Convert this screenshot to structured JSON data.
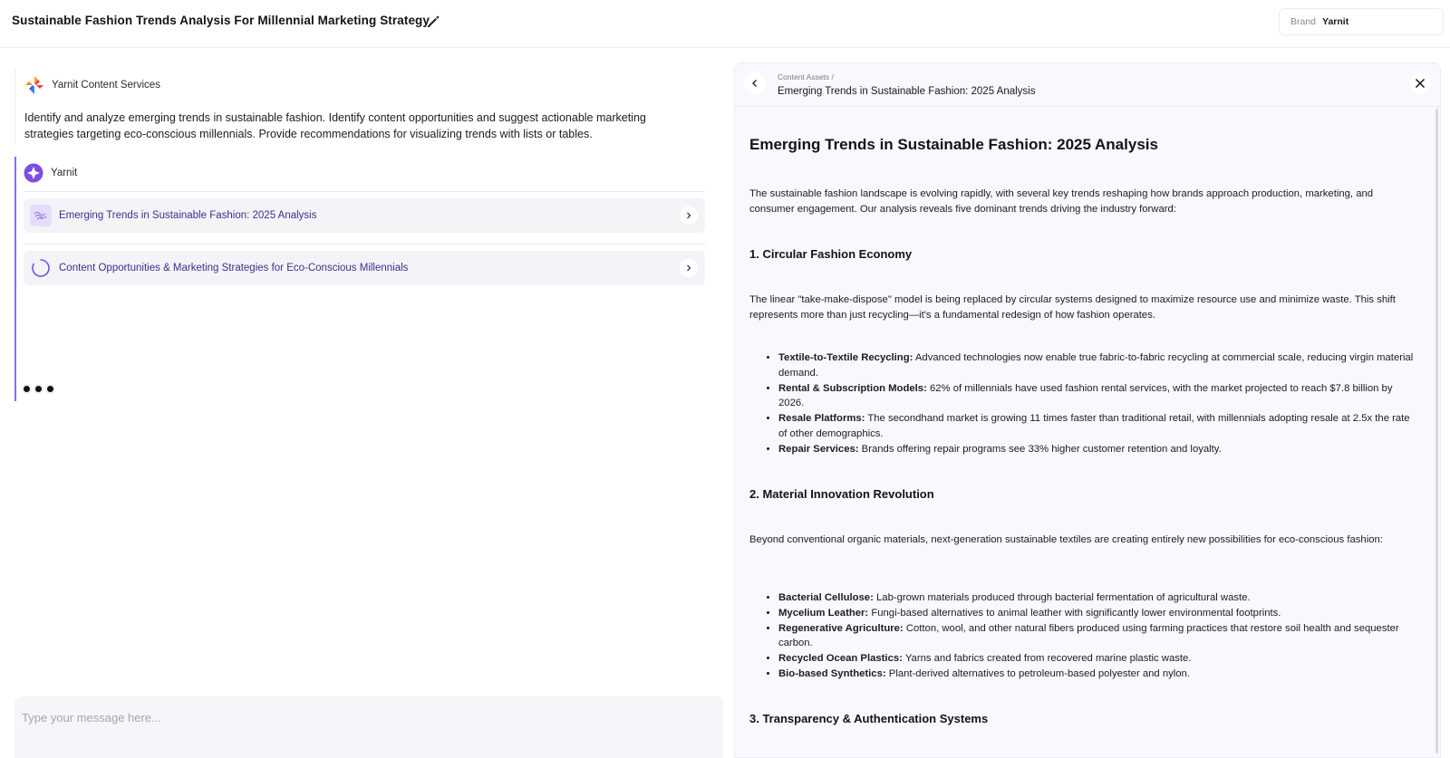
{
  "header": {
    "title": "Sustainable Fashion Trends Analysis For Millennial Marketing Strategy",
    "brand_label": "Brand",
    "brand_value": "Yarnit"
  },
  "chat": {
    "user": {
      "name": "Yarnit Content Services",
      "text": "Identify and analyze emerging trends in sustainable fashion. Identify content opportunities and suggest actionable marketing strategies targeting eco-conscious millennials. Provide recommendations for visualizing trends with lists or tables."
    },
    "bot": {
      "name": "Yarnit",
      "assets": [
        {
          "label": "Emerging Trends in Sustainable Fashion: 2025 Analysis",
          "icon": "wave-icon"
        },
        {
          "label": "Content Opportunities & Marketing Strategies for Eco-Conscious Millennials",
          "icon": "loading-spinner-icon"
        }
      ]
    },
    "composer_placeholder": "Type your message here..."
  },
  "document": {
    "breadcrumb": "Content Assets /",
    "title_small": "Emerging Trends in Sustainable Fashion: 2025 Analysis",
    "title": "Emerging Trends in Sustainable Fashion: 2025 Analysis",
    "intro": "The sustainable fashion landscape is evolving rapidly, with several key trends reshaping how brands approach production, marketing, and consumer engagement. Our analysis reveals five dominant trends driving the industry forward:",
    "sections": [
      {
        "heading": "1. Circular Fashion Economy",
        "paragraph": "The linear \"take-make-dispose\" model is being replaced by circular systems designed to maximize resource use and minimize waste. This shift represents more than just recycling—it's a fundamental redesign of how fashion operates.",
        "bullets": [
          {
            "term": "Textile-to-Textile Recycling:",
            "text": " Advanced technologies now enable true fabric-to-fabric recycling at commercial scale, reducing virgin material demand."
          },
          {
            "term": "Rental & Subscription Models:",
            "text": " 62% of millennials have used fashion rental services, with the market projected to reach $7.8 billion by 2026."
          },
          {
            "term": "Resale Platforms:",
            "text": " The secondhand market is growing 11 times faster than traditional retail, with millennials adopting resale at 2.5x the rate of other demographics."
          },
          {
            "term": "Repair Services:",
            "text": " Brands offering repair programs see 33% higher customer retention and loyalty."
          }
        ]
      },
      {
        "heading": "2. Material Innovation Revolution",
        "paragraph": "Beyond conventional organic materials, next-generation sustainable textiles are creating entirely new possibilities for eco-conscious fashion:",
        "bullets": [
          {
            "term": "Bacterial Cellulose:",
            "text": " Lab-grown materials produced through bacterial fermentation of agricultural waste."
          },
          {
            "term": "Mycelium Leather:",
            "text": " Fungi-based alternatives to animal leather with significantly lower environmental footprints."
          },
          {
            "term": "Regenerative Agriculture:",
            "text": " Cotton, wool, and other natural fibers produced using farming practices that restore soil health and sequester carbon."
          },
          {
            "term": "Recycled Ocean Plastics:",
            "text": " Yarns and fabrics created from recovered marine plastic waste."
          },
          {
            "term": "Bio-based Synthetics:",
            "text": " Plant-derived alternatives to petroleum-based polyester and nylon."
          }
        ]
      },
      {
        "heading": "3. Transparency & Authentication Systems"
      }
    ]
  },
  "colors": {
    "accent": "#8b6cf0",
    "asset_text": "#3b2f8a",
    "panel_bg": "#f8f8fe"
  }
}
